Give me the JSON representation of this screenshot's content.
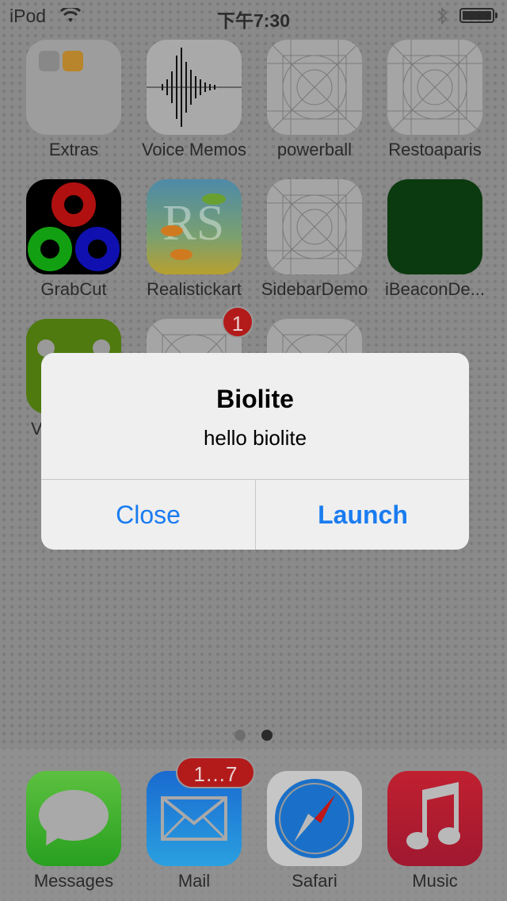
{
  "status": {
    "carrier": "iPod",
    "time": "下午7:30"
  },
  "apps": [
    {
      "label": "Extras"
    },
    {
      "label": "Voice Memos"
    },
    {
      "label": "powerball"
    },
    {
      "label": "Restoaparis"
    },
    {
      "label": "GrabCut"
    },
    {
      "label": "Realistickart"
    },
    {
      "label": "SidebarDemo"
    },
    {
      "label": "iBeaconDe..."
    },
    {
      "label": "V"
    },
    {
      "label": "",
      "badge": "1"
    },
    {
      "label": ""
    }
  ],
  "dock": [
    {
      "label": "Messages"
    },
    {
      "label": "Mail",
      "badge": "1…7"
    },
    {
      "label": "Safari"
    },
    {
      "label": "Music"
    }
  ],
  "alert": {
    "title": "Biolite",
    "message": "hello biolite",
    "cancel_label": "Close",
    "confirm_label": "Launch"
  },
  "colors": {
    "accent": "#1a7cf0",
    "badge": "#b31b1b"
  }
}
